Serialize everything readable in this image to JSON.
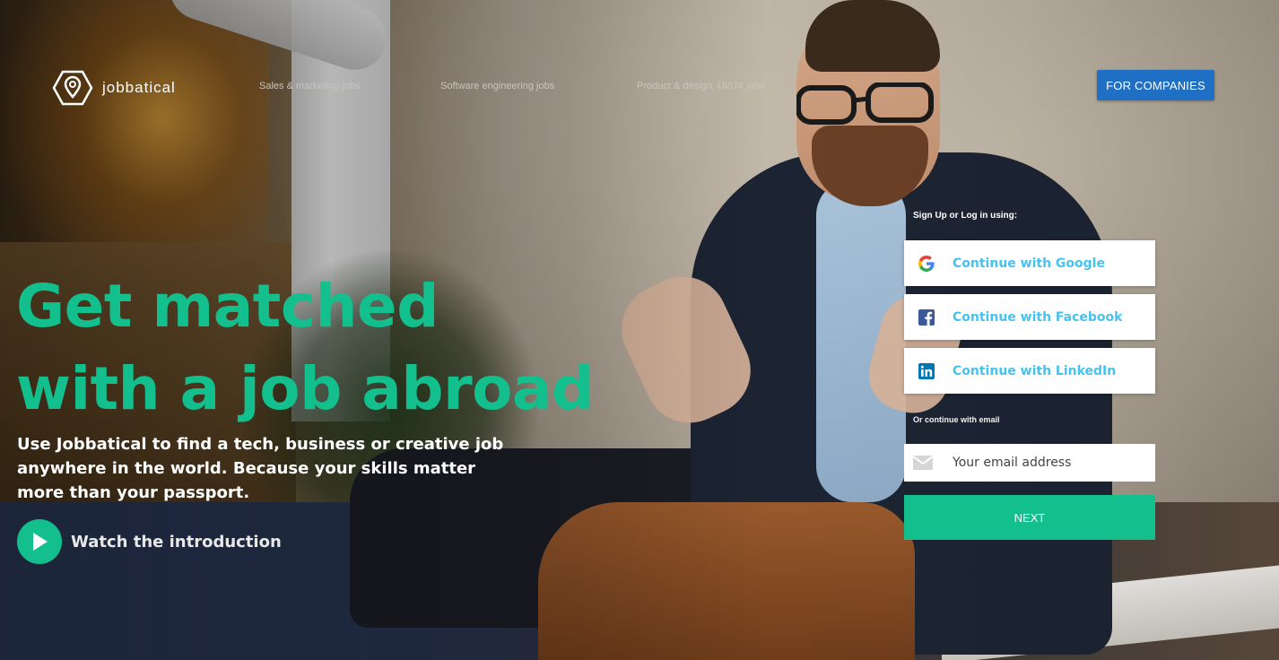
{
  "brand": {
    "name": "jobbatical",
    "accent": "#13c08d",
    "cta_blue": "#1f6fc4",
    "social_text": "#45c3f0"
  },
  "nav": {
    "links": [
      {
        "label": "Sales & marketing jobs"
      },
      {
        "label": "Software engineering jobs"
      },
      {
        "label": "Product & design, UI/UX jobs"
      }
    ],
    "companies_button": "FOR COMPANIES"
  },
  "hero": {
    "title_line1": "Get matched",
    "title_line2": "with a job abroad",
    "subtitle": "Use Jobbatical to find a tech, business or creative job anywhere in the world. Because your skills matter more than your passport.",
    "watch_label": "Watch the introduction",
    "watch_icon": "play-icon"
  },
  "signup": {
    "heading": "Sign Up or Log in using:",
    "providers": [
      {
        "label": "Continue with Google",
        "icon": "google-icon"
      },
      {
        "label": "Continue with Facebook",
        "icon": "facebook-icon"
      },
      {
        "label": "Continue with LinkedIn",
        "icon": "linkedin-icon"
      }
    ],
    "or_label": "Or continue with email",
    "email": {
      "placeholder": "Your email address",
      "value": "",
      "icon": "mail-icon"
    },
    "next_button": "NEXT"
  }
}
